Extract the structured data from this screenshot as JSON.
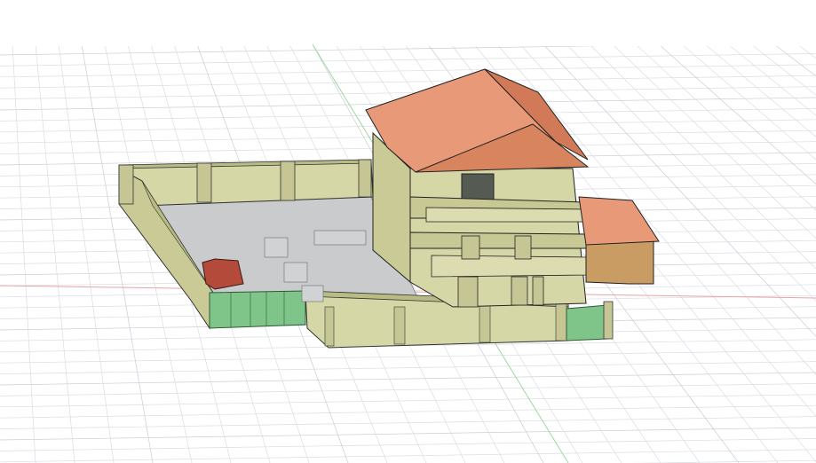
{
  "viewport": {
    "background": "#ffffff",
    "grid_color": "#d9dde2",
    "grid_major_color": "#c7ccd3",
    "axis_x_color": "#e8a3a3",
    "axis_y_color": "#9fd8a0"
  },
  "model": {
    "wall_color": "#d6d7a6",
    "wall_dark": "#b9bb85",
    "roof_color": "#e89a78",
    "roof_dark": "#d27a57",
    "gate_color": "#7fc58a",
    "ground_color": "#c9cbcc",
    "car_color": "#b44a3a"
  }
}
